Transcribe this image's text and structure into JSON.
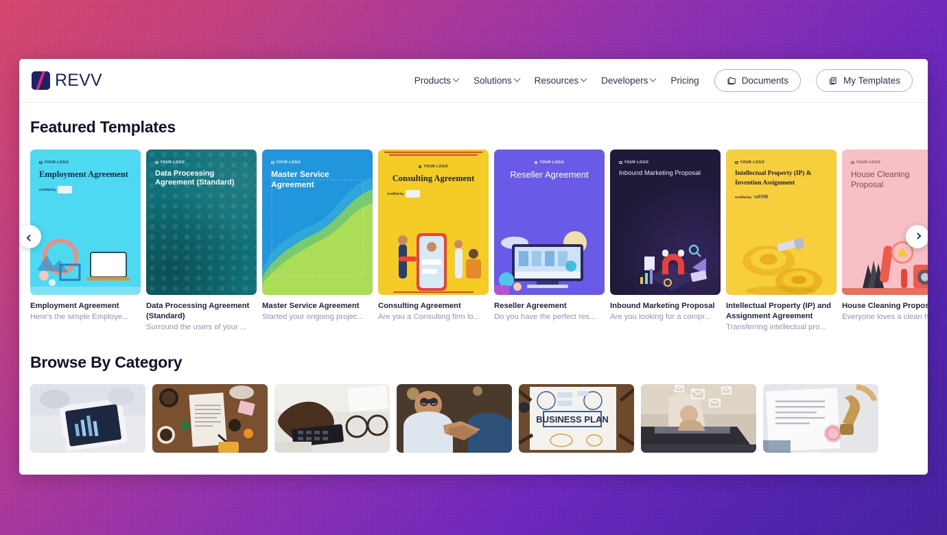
{
  "brand": {
    "name": "REVV",
    "mark": "revv-logo-mark"
  },
  "nav": {
    "links": [
      {
        "label": "Products",
        "has_chevron": true
      },
      {
        "label": "Solutions",
        "has_chevron": true
      },
      {
        "label": "Resources",
        "has_chevron": true
      },
      {
        "label": "Developers",
        "has_chevron": true
      },
      {
        "label": "Pricing",
        "has_chevron": false
      }
    ],
    "buttons": [
      {
        "label": "Documents",
        "icon": "folder-copy-icon"
      },
      {
        "label": "My Templates",
        "icon": "document-copy-icon"
      }
    ]
  },
  "sections": {
    "featured": {
      "title": "Featured Templates",
      "prev_label": "‹",
      "next_label": "›"
    },
    "categories": {
      "title": "Browse By Category"
    }
  },
  "featured_templates": [
    {
      "title": "Employment Agreement",
      "description": "Here's the simple Employe...",
      "cover_title": "Employment Agreement",
      "logo_placeholder": "YOUR LOGO",
      "certified_label": "Certified by",
      "bg_color": "#4ed9f2"
    },
    {
      "title": "Data Processing Agreement (Standard)",
      "description": "Surround the users of your ...",
      "cover_title": "Data Processing Agreement (Standard)",
      "logo_placeholder": "YOUR LOGO",
      "bg_color": "#0f7179"
    },
    {
      "title": "Master Service Agreement",
      "description": "Started your ongoing projec...",
      "cover_title": "Master Service Agreement",
      "logo_placeholder": "YOUR LOGO",
      "bg_color": "#2196dd"
    },
    {
      "title": "Consulting Agreement",
      "description": "Are you a Consulting firm lo...",
      "cover_title": "Consulting Agreement",
      "logo_placeholder": "YOUR LOGO",
      "certified_label": "Certified by",
      "bg_color": "#f5cc26"
    },
    {
      "title": "Reseller Agreement",
      "description": "Do you have the perfect res...",
      "cover_title": "Reseller Agreement",
      "logo_placeholder": "YOUR LOGO",
      "bg_color": "#6a5ae8"
    },
    {
      "title": "Inbound Marketing Proposal",
      "description": "Are you looking for a compr...",
      "cover_title": "Inbound Marketing Proposal",
      "logo_placeholder": "YOUR LOGO",
      "bg_color": "#221a3c"
    },
    {
      "title": "Intellectual Property (IP) and Assignment Agreement",
      "description": "Transferring intellectual pro...",
      "cover_title": "Intellectual Property (IP) & Invention Assignment",
      "logo_placeholder": "YOUR LOGO",
      "certified_label": "Certified by",
      "bg_color": "#f7cf3c"
    },
    {
      "title": "House Cleaning Proposal",
      "description": "Everyone loves a clean hou...",
      "cover_title": "House Cleaning Proposal",
      "logo_placeholder": "YOUR LOGO",
      "bg_color": "#f7c0c6"
    }
  ],
  "categories": [
    {
      "image": "tablet-business-report-photo"
    },
    {
      "image": "contract-signing-desk-photo"
    },
    {
      "image": "calculator-glasses-desk-photo"
    },
    {
      "image": "business-handshake-photo"
    },
    {
      "image": "business-plan-whiteboard-photo"
    },
    {
      "image": "laptop-typing-email-photo"
    },
    {
      "image": "wax-seal-document-photo"
    }
  ],
  "theme": {
    "background_gradient_start": "#d4466c",
    "background_gradient_end": "#45219f",
    "brand_navy": "#1b2468",
    "brand_pink": "#e8236f",
    "panel_background": "#ffffff"
  }
}
